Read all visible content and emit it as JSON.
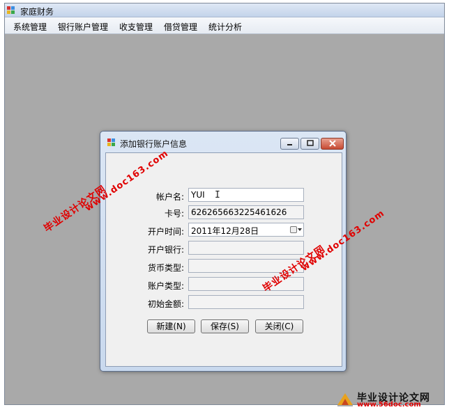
{
  "main_window": {
    "title": "家庭财务"
  },
  "menu": [
    "系统管理",
    "银行账户管理",
    "收支管理",
    "借贷管理",
    "统计分析"
  ],
  "dialog": {
    "title": "添加银行账户信息",
    "buttons": {
      "minimize": "minimize-icon",
      "maximize": "maximize-icon",
      "close": "close-icon"
    }
  },
  "form": {
    "account_name": {
      "label": "帐户名:",
      "value": "YUI"
    },
    "card_no": {
      "label": "卡号:",
      "value": "626265663225461626"
    },
    "open_date": {
      "label": "开户时间:",
      "value": "2011年12月28日"
    },
    "bank": {
      "label": "开户银行:",
      "value": ""
    },
    "currency": {
      "label": "货币类型:",
      "value": ""
    },
    "account_type": {
      "label": "账户类型:",
      "value": ""
    },
    "initial_amount": {
      "label": "初始金额:",
      "value": ""
    }
  },
  "actions": {
    "new": "新建(N)",
    "save": "保存(S)",
    "close": "关闭(C)"
  },
  "watermarks": {
    "url": "www.doc163.com",
    "cn": "毕业设计论文网"
  },
  "logo": {
    "title": "毕业设计论文网",
    "url": "www.56doc.com"
  },
  "colors": {
    "watermark": "#e00000",
    "desktop": "#a9a9a9"
  }
}
